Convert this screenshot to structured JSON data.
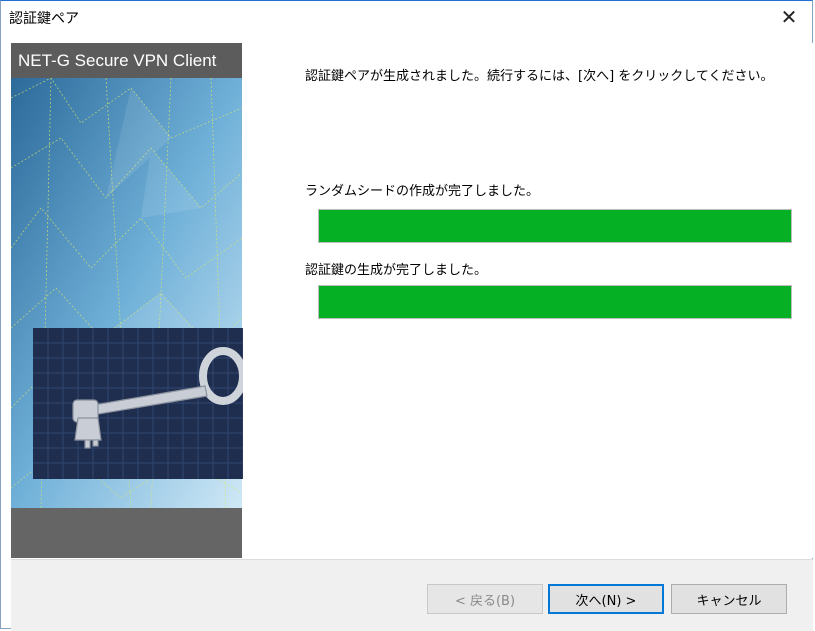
{
  "window": {
    "title": "認証鍵ペア",
    "close_glyph": "✕"
  },
  "banner": {
    "brand": "NET-G Secure VPN Client",
    "key_image_icon": "key-icon"
  },
  "content": {
    "message": "認証鍵ペアが生成されました。続行するには、[次へ] をクリックしてください。",
    "steps": [
      {
        "label": "ランダムシードの作成が完了しました。",
        "progress": 1.0
      },
      {
        "label": "認証鍵の生成が完了しました。",
        "progress": 1.0
      }
    ],
    "progress_color": "#06b025"
  },
  "buttons": {
    "back": "< 戻る(B)",
    "next": "次へ(N) >",
    "cancel": "キャンセル"
  }
}
